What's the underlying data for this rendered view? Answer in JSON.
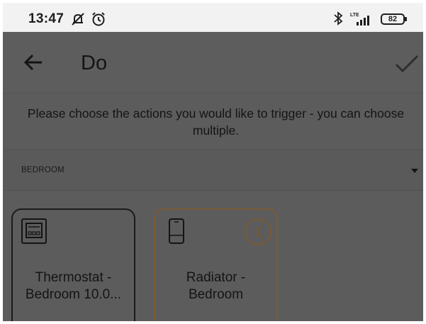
{
  "status_bar": {
    "time": "13:47",
    "battery": "82",
    "network": "LTE",
    "icons": [
      "do-not-disturb-icon",
      "alarm-icon",
      "bluetooth-icon",
      "signal-icon",
      "battery-icon"
    ]
  },
  "app_bar": {
    "title": "Do",
    "back_icon": "arrow-left-icon",
    "confirm_icon": "check-icon"
  },
  "instruction": "Please choose the actions you would like to trigger - you can choose multiple.",
  "room_selector": {
    "label": "BEDROOM",
    "icon": "caret-down-icon"
  },
  "devices": [
    {
      "name": "Thermostat - Bedroom 10.0...",
      "icon": "thermostat-icon",
      "selected": false
    },
    {
      "name": "Radiator - Bedroom",
      "icon": "radiator-valve-icon",
      "selected": true,
      "badge": "1"
    }
  ],
  "colors": {
    "accent": "#7a5a35",
    "overlay_background": "#5c5c5c",
    "status_bar": "#f2f2f2"
  }
}
